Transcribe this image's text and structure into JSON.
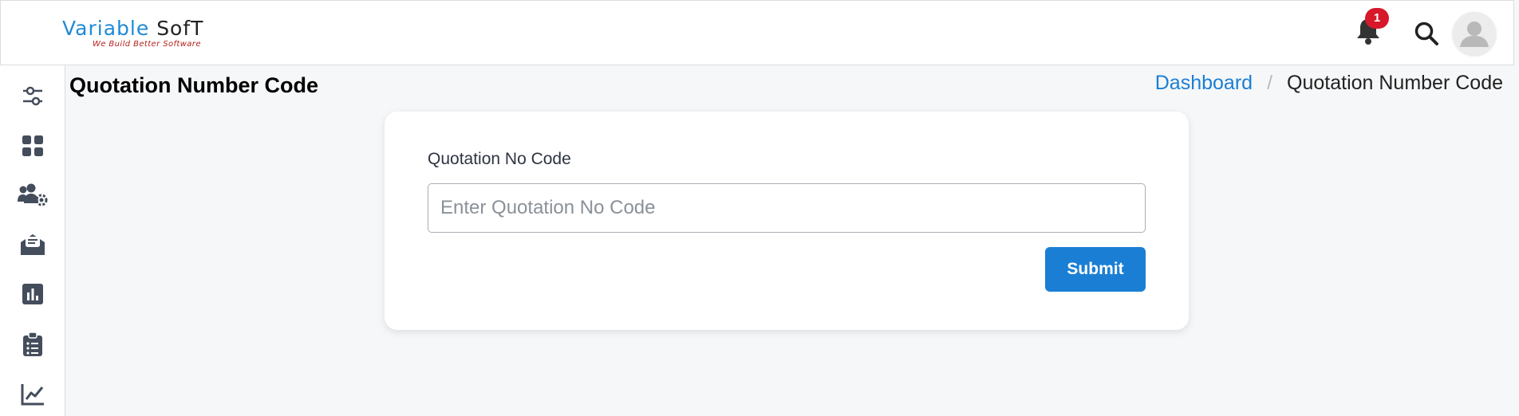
{
  "header": {
    "logo_main_blue": "Variable",
    "logo_main_dark": "SofT",
    "logo_tagline": "We Build Better Software",
    "notification_count": "1",
    "icons": [
      "bell-icon",
      "search-icon",
      "user-avatar-icon"
    ]
  },
  "sidebar": {
    "items": [
      {
        "name": "settings-sliders",
        "icon": "sliders-icon"
      },
      {
        "name": "dashboard",
        "icon": "grid-icon"
      },
      {
        "name": "users",
        "icon": "users-gear-icon"
      },
      {
        "name": "mail",
        "icon": "envelope-open-icon"
      },
      {
        "name": "reports",
        "icon": "bar-chart-icon"
      },
      {
        "name": "tasks",
        "icon": "clipboard-list-icon"
      },
      {
        "name": "analytics",
        "icon": "line-chart-icon"
      }
    ]
  },
  "page": {
    "title": "Quotation Number Code"
  },
  "breadcrumb": {
    "link": "Dashboard",
    "separator": "/",
    "current": "Quotation Number Code"
  },
  "form": {
    "label": "Quotation No Code",
    "placeholder": "Enter Quotation No Code",
    "value": "",
    "submit_label": "Submit"
  },
  "colors": {
    "accent": "#1a7fd4",
    "badge": "#d7182a",
    "logo_blue": "#1f8ad6",
    "tagline_red": "#b3201c"
  }
}
